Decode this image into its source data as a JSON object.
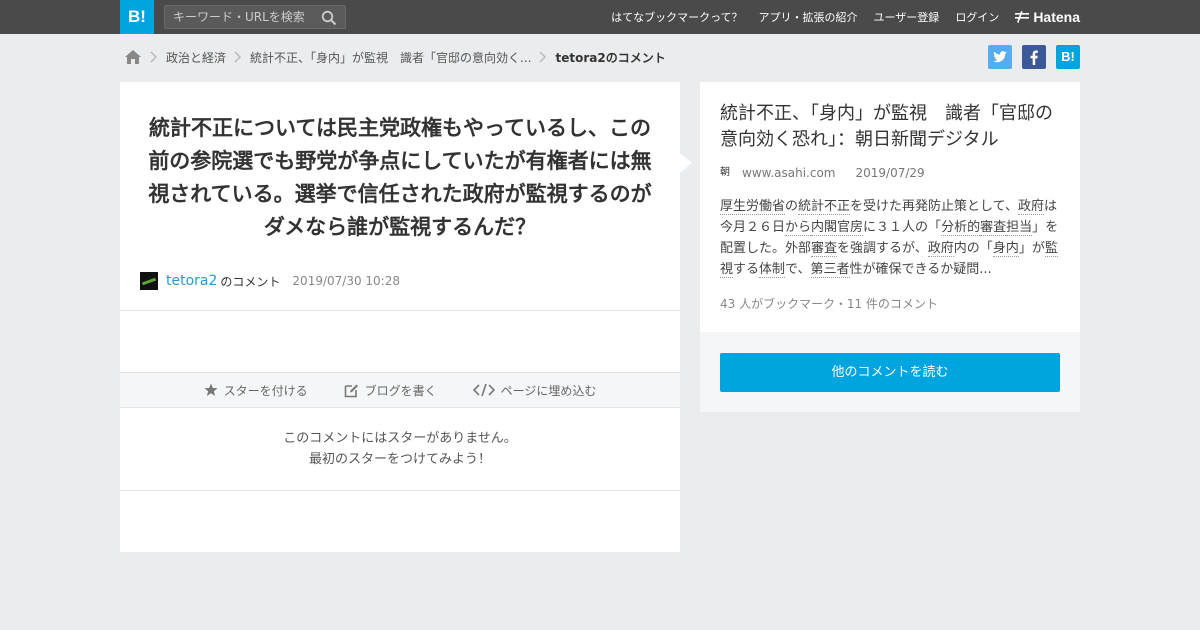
{
  "header": {
    "logo_text": "B!",
    "search_placeholder": "キーワード・URLを検索",
    "nav": [
      "はてなブックマークって？",
      "アプリ・拡張の紹介",
      "ユーザー登録",
      "ログイン"
    ],
    "brand": "Hatena"
  },
  "breadcrumb": {
    "category": "政治と経済",
    "article": "統計不正、「身内」が監視　識者「官邸の意向効く...",
    "current": "tetora2のコメント"
  },
  "share": {
    "twitter": "t",
    "facebook": "f",
    "hatena": "B!"
  },
  "comment": {
    "text": "統計不正については民主党政権もやっているし、この前の参院選でも野党が争点にしていたが有権者には無視されている。選挙で信任された政府が監視するのがダメなら誰が監視するんだ？",
    "user": "tetora2",
    "user_suffix": "のコメント",
    "date": "2019/07/30 10:28"
  },
  "actions": {
    "star": "スターを付ける",
    "blog": "ブログを書く",
    "embed": "ページに埋め込む"
  },
  "no_star": {
    "line1": "このコメントにはスターがありません。",
    "line2": "最初のスターをつけてみよう！"
  },
  "entry": {
    "title": "統計不正、「身内」が監視　識者「官邸の意向効く恐れ」：朝日新聞デジタル",
    "favicon": "朝",
    "domain": "www.asahi.com",
    "date": "2019/07/29",
    "desc_parts": [
      {
        "t": "厚生労働省",
        "u": true
      },
      {
        "t": "の",
        "u": false
      },
      {
        "t": "統計不正",
        "u": true
      },
      {
        "t": "を受けた再発防止策として、",
        "u": false
      },
      {
        "t": "政府",
        "u": true
      },
      {
        "t": "は今月２６日",
        "u": false
      },
      {
        "t": "から",
        "u": true
      },
      {
        "t": "内閣官房",
        "u": true
      },
      {
        "t": "に３１人の「",
        "u": false
      },
      {
        "t": "分析的",
        "u": true
      },
      {
        "t": "審査",
        "u": true
      },
      {
        "t": "担当",
        "u": true
      },
      {
        "t": "」を配置した。外部",
        "u": false
      },
      {
        "t": "審査",
        "u": true
      },
      {
        "t": "を強調するが、",
        "u": false
      },
      {
        "t": "政府",
        "u": true
      },
      {
        "t": "内の「",
        "u": false
      },
      {
        "t": "身内",
        "u": true
      },
      {
        "t": "」が",
        "u": false
      },
      {
        "t": "監視",
        "u": true
      },
      {
        "t": "する",
        "u": false
      },
      {
        "t": "体制",
        "u": true
      },
      {
        "t": "で、",
        "u": false
      },
      {
        "t": "第三者",
        "u": true
      },
      {
        "t": "性が確保できるか疑問...",
        "u": false
      }
    ],
    "count": "43 人がブックマーク・11 件のコメント",
    "read_button": "他のコメントを読む"
  }
}
